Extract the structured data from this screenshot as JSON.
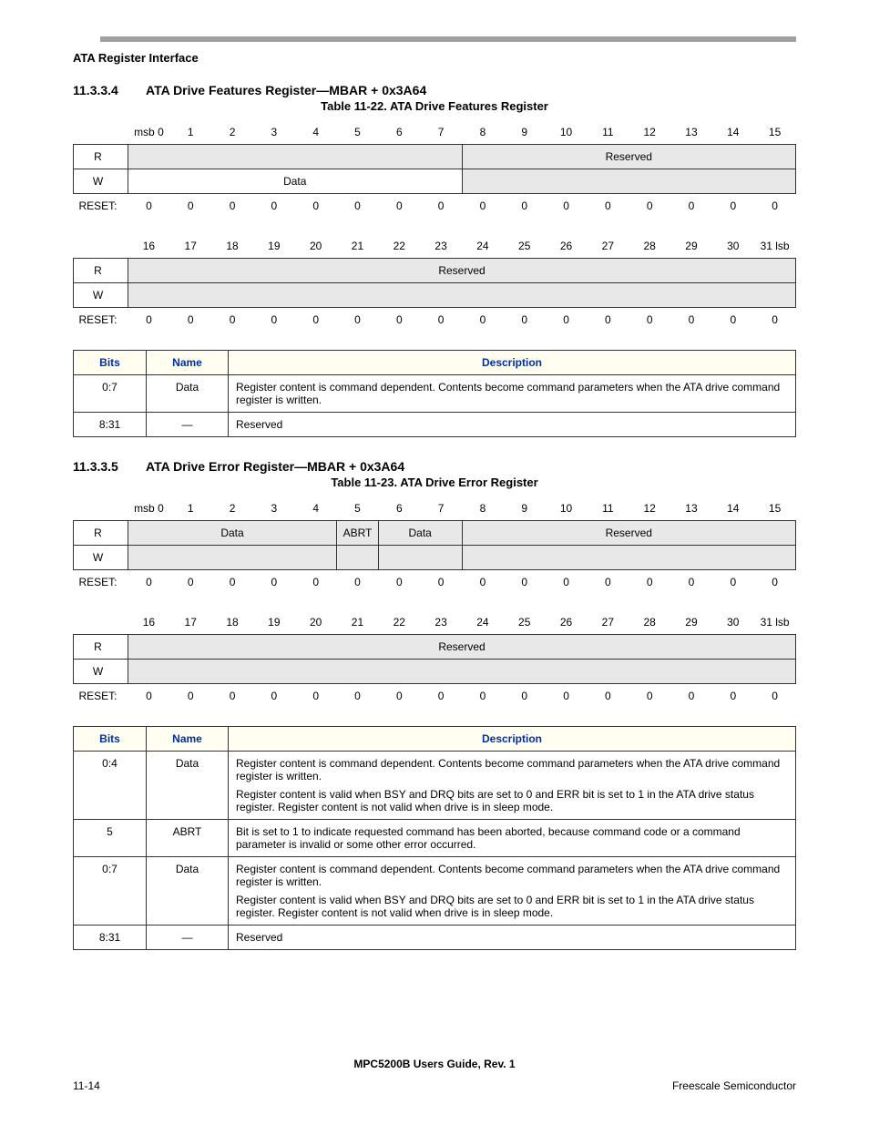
{
  "header": "ATA Register Interface",
  "sections": [
    {
      "num": "11.3.3.4",
      "title": "ATA Drive Features Register—MBAR + 0x3A64",
      "caption": "Table 11-22. ATA Drive Features Register",
      "bits_hi": [
        "msb 0",
        "1",
        "2",
        "3",
        "4",
        "5",
        "6",
        "7",
        "8",
        "9",
        "10",
        "11",
        "12",
        "13",
        "14",
        "15"
      ],
      "bits_lo": [
        "16",
        "17",
        "18",
        "19",
        "20",
        "21",
        "22",
        "23",
        "24",
        "25",
        "26",
        "27",
        "28",
        "29",
        "30",
        "31 lsb"
      ],
      "r_hi": [
        {
          "span": 8,
          "label": "",
          "shade": true
        },
        {
          "span": 8,
          "label": "Reserved",
          "shade": true
        }
      ],
      "w_hi": [
        {
          "span": 8,
          "label": "Data",
          "shade": false
        },
        {
          "span": 8,
          "label": "",
          "shade": true
        }
      ],
      "r_lo": [
        {
          "span": 16,
          "label": "Reserved",
          "shade": true
        }
      ],
      "w_lo": [
        {
          "span": 16,
          "label": "",
          "shade": true
        }
      ],
      "reset_hi": [
        "0",
        "0",
        "0",
        "0",
        "0",
        "0",
        "0",
        "0",
        "0",
        "0",
        "0",
        "0",
        "0",
        "0",
        "0",
        "0"
      ],
      "reset_lo": [
        "0",
        "0",
        "0",
        "0",
        "0",
        "0",
        "0",
        "0",
        "0",
        "0",
        "0",
        "0",
        "0",
        "0",
        "0",
        "0"
      ],
      "desc_headers": [
        "Bits",
        "Name",
        "Description"
      ],
      "desc_rows": [
        {
          "bits": "0:7",
          "name": "Data",
          "paras": [
            "Register content is command dependent. Contents become command parameters when the ATA drive command register is written."
          ]
        },
        {
          "bits": "8:31",
          "name": "—",
          "paras": [
            "Reserved"
          ]
        }
      ]
    },
    {
      "num": "11.3.3.5",
      "title": "ATA Drive Error Register—MBAR + 0x3A64",
      "caption": "Table 11-23. ATA Drive Error Register",
      "bits_hi": [
        "msb 0",
        "1",
        "2",
        "3",
        "4",
        "5",
        "6",
        "7",
        "8",
        "9",
        "10",
        "11",
        "12",
        "13",
        "14",
        "15"
      ],
      "bits_lo": [
        "16",
        "17",
        "18",
        "19",
        "20",
        "21",
        "22",
        "23",
        "24",
        "25",
        "26",
        "27",
        "28",
        "29",
        "30",
        "31 lsb"
      ],
      "r_hi": [
        {
          "span": 5,
          "label": "Data",
          "shade": true
        },
        {
          "span": 1,
          "label": "ABRT",
          "shade": true
        },
        {
          "span": 2,
          "label": "Data",
          "shade": true
        },
        {
          "span": 8,
          "label": "Reserved",
          "shade": true
        }
      ],
      "w_hi": [
        {
          "span": 5,
          "label": "",
          "shade": true
        },
        {
          "span": 1,
          "label": "",
          "shade": true
        },
        {
          "span": 2,
          "label": "",
          "shade": true
        },
        {
          "span": 8,
          "label": "",
          "shade": true
        }
      ],
      "r_lo": [
        {
          "span": 16,
          "label": "Reserved",
          "shade": true
        }
      ],
      "w_lo": [
        {
          "span": 16,
          "label": "",
          "shade": true
        }
      ],
      "reset_hi": [
        "0",
        "0",
        "0",
        "0",
        "0",
        "0",
        "0",
        "0",
        "0",
        "0",
        "0",
        "0",
        "0",
        "0",
        "0",
        "0"
      ],
      "reset_lo": [
        "0",
        "0",
        "0",
        "0",
        "0",
        "0",
        "0",
        "0",
        "0",
        "0",
        "0",
        "0",
        "0",
        "0",
        "0",
        "0"
      ],
      "desc_headers": [
        "Bits",
        "Name",
        "Description"
      ],
      "desc_rows": [
        {
          "bits": "0:4",
          "name": "Data",
          "paras": [
            "Register content is command dependent. Contents become command parameters when the ATA drive command register is written.",
            "Register content is valid when BSY and DRQ bits are set to 0 and ERR bit is set to 1 in the ATA drive status register. Register content is not valid when drive is in sleep mode."
          ]
        },
        {
          "bits": "5",
          "name": "ABRT",
          "paras": [
            "Bit is set to 1 to indicate requested command has been aborted, because command code or a command parameter is invalid or some other error occurred."
          ]
        },
        {
          "bits": "0:7",
          "name": "Data",
          "paras": [
            "Register content is command dependent. Contents become command parameters when the ATA drive command register is written.",
            "Register content is valid when BSY and DRQ bits are set to 0 and ERR bit is set to 1 in the ATA drive status register. Register content is not valid when drive is in sleep mode."
          ]
        },
        {
          "bits": "8:31",
          "name": "—",
          "paras": [
            "Reserved"
          ]
        }
      ]
    }
  ],
  "labels": {
    "R": "R",
    "W": "W",
    "RESET": "RESET:"
  },
  "footer": {
    "center": "MPC5200B Users Guide, Rev. 1",
    "left": "11-14",
    "right": "Freescale Semiconductor"
  }
}
